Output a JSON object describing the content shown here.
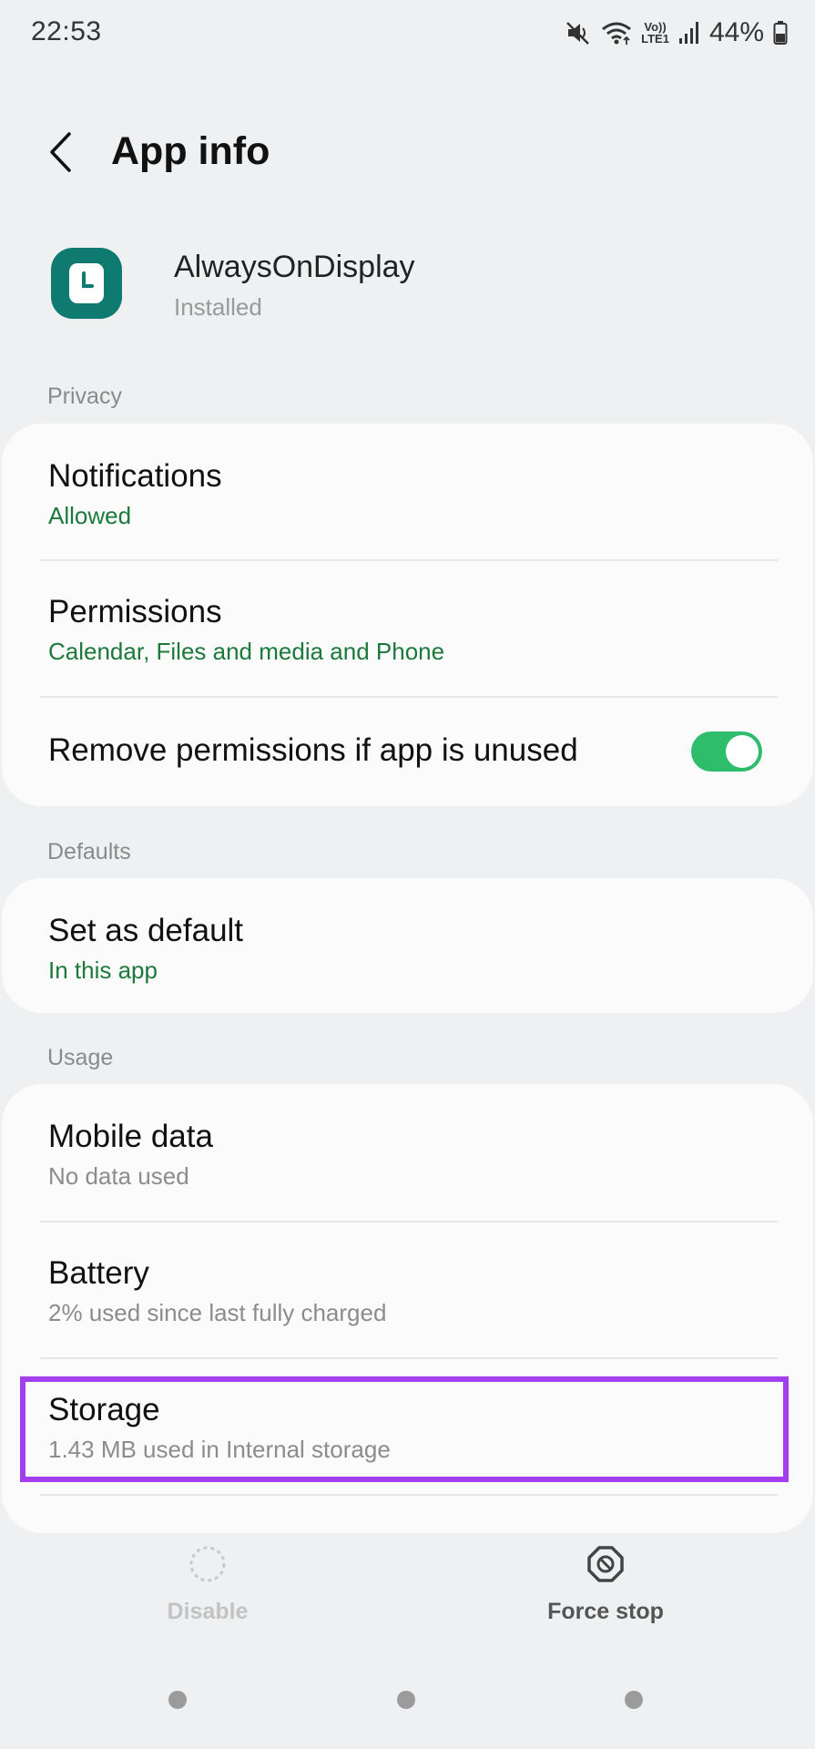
{
  "status_bar": {
    "time": "22:53",
    "network_label_top": "Vo))",
    "network_label_bottom": "LTE1",
    "battery_percent": "44%"
  },
  "header": {
    "title": "App info",
    "back_icon": "chevron-left-icon"
  },
  "app": {
    "name": "AlwaysOnDisplay",
    "status": "Installed",
    "icon": "clock-icon",
    "icon_color": "#0e7a70"
  },
  "sections": {
    "privacy": {
      "label": "Privacy",
      "items": [
        {
          "title": "Notifications",
          "subtitle": "Allowed"
        },
        {
          "title": "Permissions",
          "subtitle": "Calendar, Files and media and Phone"
        },
        {
          "title": "Remove permissions if app is unused",
          "toggle_on": true
        }
      ]
    },
    "defaults": {
      "label": "Defaults",
      "items": [
        {
          "title": "Set as default",
          "subtitle": "In this app"
        }
      ]
    },
    "usage": {
      "label": "Usage",
      "items": [
        {
          "title": "Mobile data",
          "subtitle": "No data used"
        },
        {
          "title": "Battery",
          "subtitle": "2% used since last fully charged"
        },
        {
          "title": "Storage",
          "subtitle": "1.43 MB used in Internal storage"
        }
      ]
    }
  },
  "bottom_actions": {
    "disable_label": "Disable",
    "force_stop_label": "Force stop"
  },
  "colors": {
    "accent_green": "#2ebd6b",
    "highlight": "#a43ff0",
    "subtitle_green": "#1b7a3b"
  }
}
